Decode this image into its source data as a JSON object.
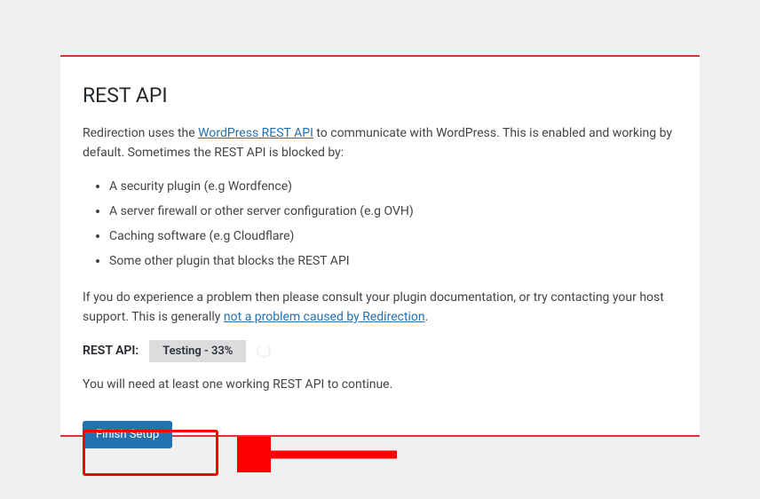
{
  "heading": "REST API",
  "intro": {
    "prefix": "Redirection uses the ",
    "link_text": "WordPress REST API",
    "suffix": " to communicate with WordPress. This is enabled and working by default. Sometimes the REST API is blocked by:"
  },
  "blockers": [
    "A security plugin (e.g Wordfence)",
    "A server firewall or other server configuration (e.g OVH)",
    "Caching software (e.g Cloudflare)",
    "Some other plugin that blocks the REST API"
  ],
  "problem": {
    "prefix": "If you do experience a problem then please consult your plugin documentation, or try contacting your host support. This is generally ",
    "link_text": "not a problem caused by Redirection",
    "suffix": "."
  },
  "status": {
    "label": "REST API:",
    "value": "Testing - 33%"
  },
  "note": "You will need at least one working REST API to continue.",
  "button": "Finish Setup"
}
